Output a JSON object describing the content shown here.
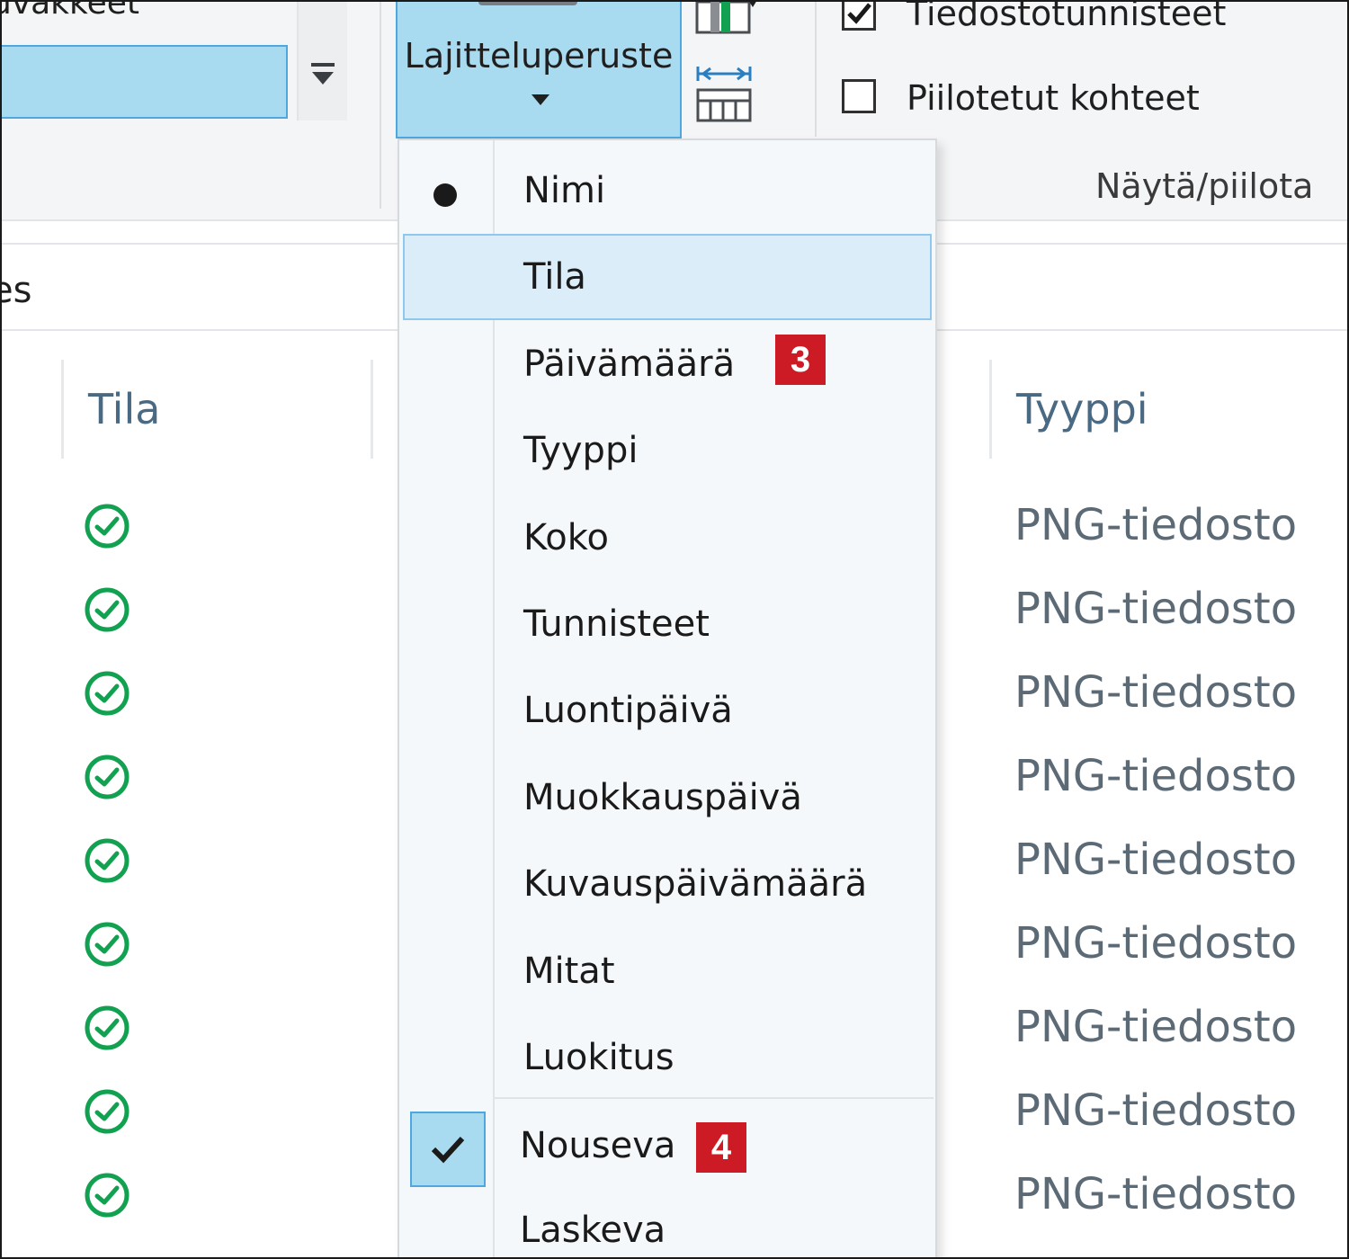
{
  "ribbon": {
    "left_group_label": "uvakkeet",
    "sort_button_label": "Lajitteluperuste",
    "show_hide": {
      "extensions_label": "Tiedostotunnisteet",
      "extensions_checked": true,
      "hidden_items_label": "Piilotetut kohteet",
      "hidden_items_checked": false,
      "group_label": "Näytä/piilota"
    }
  },
  "address_bar": {
    "visible_fragment": "es"
  },
  "file_list": {
    "columns": {
      "status": "Tila",
      "type": "Tyyppi"
    },
    "rows": [
      {
        "status_icon": "synced-check-icon",
        "type": "PNG-tiedosto"
      },
      {
        "status_icon": "synced-check-icon",
        "type": "PNG-tiedosto"
      },
      {
        "status_icon": "synced-check-icon",
        "type": "PNG-tiedosto"
      },
      {
        "status_icon": "synced-check-icon",
        "type": "PNG-tiedosto"
      },
      {
        "status_icon": "synced-check-icon",
        "type": "PNG-tiedosto"
      },
      {
        "status_icon": "synced-check-icon",
        "type": "PNG-tiedosto"
      },
      {
        "status_icon": "synced-check-icon",
        "type": "PNG-tiedosto"
      },
      {
        "status_icon": "synced-check-icon",
        "type": "PNG-tiedosto"
      },
      {
        "status_icon": "synced-check-icon",
        "type": "PNG-tiedosto"
      }
    ]
  },
  "sort_menu": {
    "items": [
      {
        "label": "Nimi",
        "selected": true
      },
      {
        "label": "Tila",
        "highlighted": true
      },
      {
        "label": "Päivämäärä"
      },
      {
        "label": "Tyyppi"
      },
      {
        "label": "Koko"
      },
      {
        "label": "Tunnisteet"
      },
      {
        "label": "Luontipäivä"
      },
      {
        "label": "Muokkauspäivä"
      },
      {
        "label": "Kuvauspäivämäärä"
      },
      {
        "label": "Mitat"
      },
      {
        "label": "Luokitus"
      }
    ],
    "order_items": [
      {
        "label": "Nouseva",
        "checked": true
      },
      {
        "label": "Laskeva",
        "checked": false
      }
    ]
  },
  "callouts": {
    "date_badge": "3",
    "ascending_badge": "4"
  },
  "colors": {
    "accent": "#4ea7de",
    "selection_fill": "#a8daf0",
    "status_green": "#12a150",
    "badge_red": "#cc1b24"
  }
}
